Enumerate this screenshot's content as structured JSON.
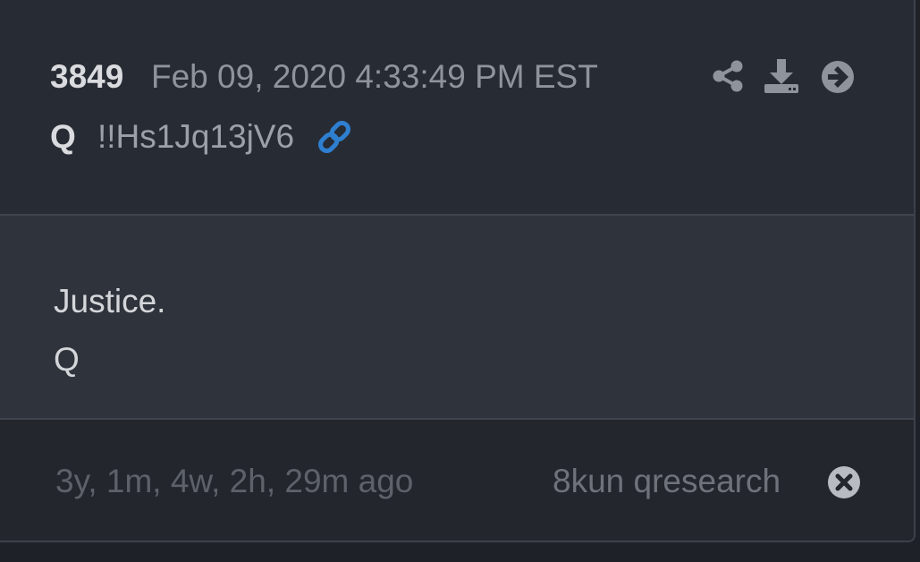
{
  "post": {
    "number": "3849",
    "date": "Feb 09, 2020 4:33:49 PM EST",
    "author": "Q",
    "tripcode": "!!Hs1Jq13jV6",
    "body_lines": [
      "Justice.",
      "Q"
    ],
    "ago": "3y, 1m, 4w, 2h, 29m ago",
    "source": "8kun qresearch"
  },
  "icons": {
    "link": "link-icon",
    "share": "share-icon",
    "download": "download-icon",
    "next": "arrow-right-circle-icon",
    "close": "close-circle-icon"
  },
  "colors": {
    "link_accent": "#2f7fd0",
    "icon_gray": "#8f949c"
  }
}
